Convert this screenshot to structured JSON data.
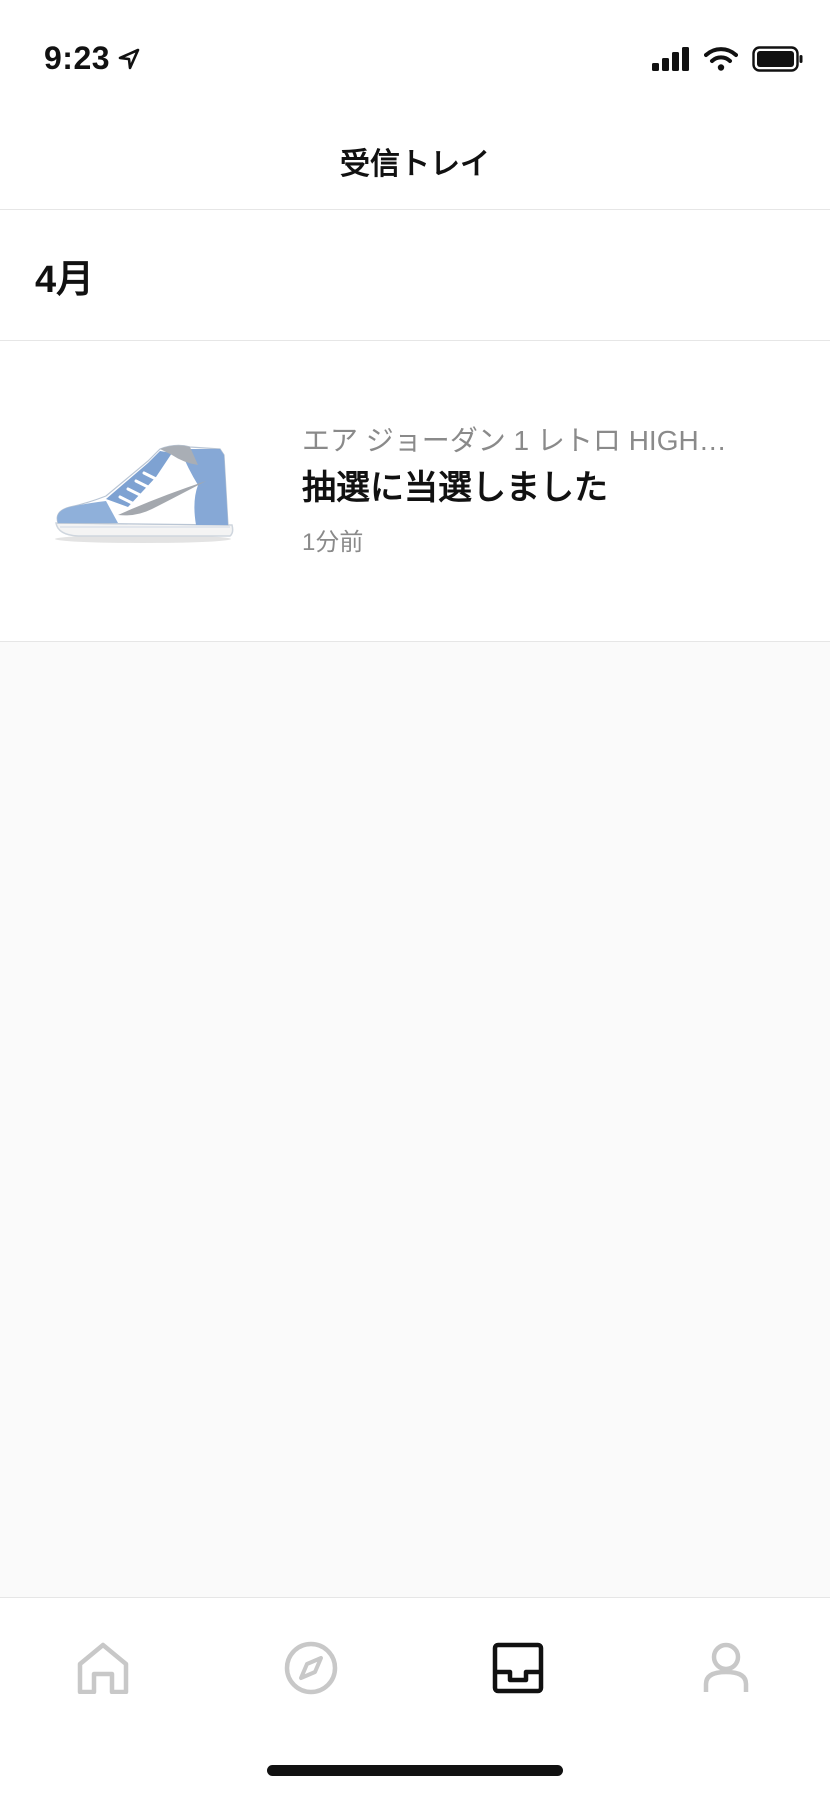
{
  "status_bar": {
    "time": "9:23",
    "icons": [
      "location-arrow-icon",
      "signal-icon",
      "wifi-icon",
      "battery-icon"
    ]
  },
  "nav": {
    "title": "受信トレイ"
  },
  "section": {
    "title": "4月"
  },
  "notifications": [
    {
      "product": "エア ジョーダン 1 レトロ HIGH…",
      "message": "抽選に当選しました",
      "time": "1分前",
      "thumbnail": "sneaker-image"
    }
  ],
  "tabs": [
    {
      "icon": "home-icon",
      "active": false
    },
    {
      "icon": "compass-icon",
      "active": false
    },
    {
      "icon": "inbox-icon",
      "active": true
    },
    {
      "icon": "profile-icon",
      "active": false
    }
  ],
  "colors": {
    "active_tab": "#111111",
    "inactive_tab": "#c8c8c8",
    "secondary_text": "#8a8a8a",
    "sneaker_blue": "#7fa4d4",
    "background": "#fafafa"
  }
}
